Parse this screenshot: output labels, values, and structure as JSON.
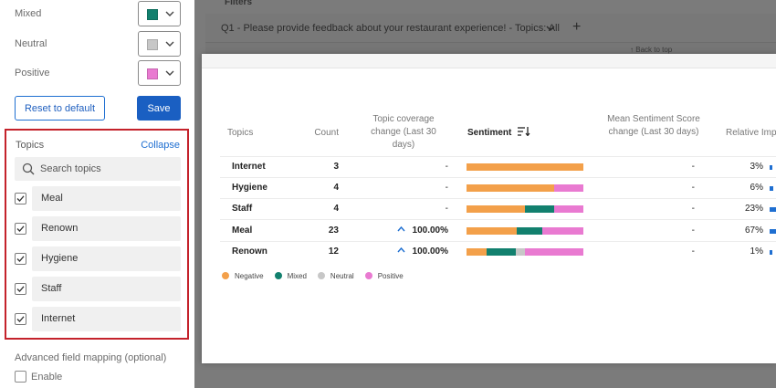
{
  "colors": {
    "negative": "#f3a04a",
    "mixed": "#12806e",
    "neutral": "#c7c7c7",
    "positive": "#e97ad1",
    "primary": "#1a5fc2",
    "highlight_border": "#c4222b"
  },
  "color_settings": [
    {
      "label": "Mixed",
      "swatch": "#12806e"
    },
    {
      "label": "Neutral",
      "swatch": "#c7c7c7"
    },
    {
      "label": "Positive",
      "swatch": "#e97ad1"
    }
  ],
  "buttons": {
    "reset": "Reset to default",
    "save": "Save"
  },
  "topics_panel": {
    "title": "Topics",
    "collapse": "Collapse",
    "search_placeholder": "Search topics",
    "items": [
      {
        "label": "Meal",
        "checked": true
      },
      {
        "label": "Renown",
        "checked": true
      },
      {
        "label": "Hygiene",
        "checked": true
      },
      {
        "label": "Staff",
        "checked": true
      },
      {
        "label": "Internet",
        "checked": true
      }
    ]
  },
  "advanced": {
    "title": "Advanced field mapping (optional)",
    "enable_label": "Enable",
    "enabled": false
  },
  "background": {
    "filters": "Filters",
    "question": "Q1 - Please provide feedback about your restaurant experience! - Topics: All",
    "back_to_top": "Back to top"
  },
  "table": {
    "headers": {
      "topics": "Topics",
      "count": "Count",
      "coverage": "Topic coverage change (Last 30 days)",
      "sentiment": "Sentiment",
      "mean": "Mean Sentiment Score change (Last 30 days)",
      "relative": "Relative Imp"
    },
    "rows": [
      {
        "topic": "Internet",
        "count": "3",
        "coverage": "-",
        "coverage_up": false,
        "sentiment": {
          "negative": 1.0,
          "mixed": 0,
          "neutral": 0,
          "positive": 0
        },
        "mean": "-",
        "relative": "3%",
        "relative_fraction": 0.03
      },
      {
        "topic": "Hygiene",
        "count": "4",
        "coverage": "-",
        "coverage_up": false,
        "sentiment": {
          "negative": 0.75,
          "mixed": 0,
          "neutral": 0,
          "positive": 0.25
        },
        "mean": "-",
        "relative": "6%",
        "relative_fraction": 0.06
      },
      {
        "topic": "Staff",
        "count": "4",
        "coverage": "-",
        "coverage_up": false,
        "sentiment": {
          "negative": 0.5,
          "mixed": 0.25,
          "neutral": 0,
          "positive": 0.25
        },
        "mean": "-",
        "relative": "23%",
        "relative_fraction": 0.23
      },
      {
        "topic": "Meal",
        "count": "23",
        "coverage": "100.00%",
        "coverage_up": true,
        "sentiment": {
          "negative": 0.43,
          "mixed": 0.22,
          "neutral": 0,
          "positive": 0.35
        },
        "mean": "-",
        "relative": "67%",
        "relative_fraction": 0.67
      },
      {
        "topic": "Renown",
        "count": "12",
        "coverage": "100.00%",
        "coverage_up": true,
        "sentiment": {
          "negative": 0.17,
          "mixed": 0.25,
          "neutral": 0.08,
          "positive": 0.5
        },
        "mean": "-",
        "relative": "1%",
        "relative_fraction": 0.01
      }
    ],
    "legend": [
      "Negative",
      "Mixed",
      "Neutral",
      "Positive"
    ]
  }
}
